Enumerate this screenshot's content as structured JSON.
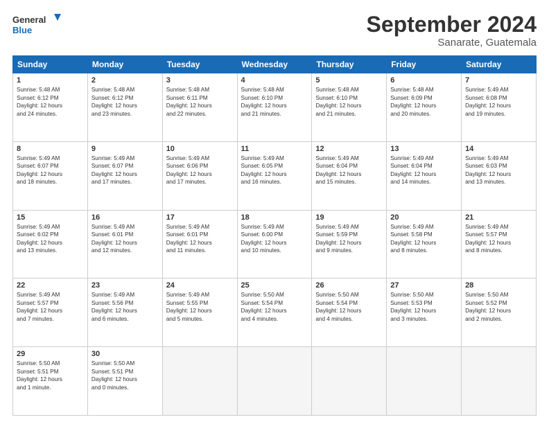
{
  "header": {
    "logo_line1": "General",
    "logo_line2": "Blue",
    "month_title": "September 2024",
    "subtitle": "Sanarate, Guatemala"
  },
  "days_of_week": [
    "Sunday",
    "Monday",
    "Tuesday",
    "Wednesday",
    "Thursday",
    "Friday",
    "Saturday"
  ],
  "weeks": [
    [
      {
        "day": "1",
        "text": "Sunrise: 5:48 AM\nSunset: 6:12 PM\nDaylight: 12 hours\nand 24 minutes."
      },
      {
        "day": "2",
        "text": "Sunrise: 5:48 AM\nSunset: 6:12 PM\nDaylight: 12 hours\nand 23 minutes."
      },
      {
        "day": "3",
        "text": "Sunrise: 5:48 AM\nSunset: 6:11 PM\nDaylight: 12 hours\nand 22 minutes."
      },
      {
        "day": "4",
        "text": "Sunrise: 5:48 AM\nSunset: 6:10 PM\nDaylight: 12 hours\nand 21 minutes."
      },
      {
        "day": "5",
        "text": "Sunrise: 5:48 AM\nSunset: 6:10 PM\nDaylight: 12 hours\nand 21 minutes."
      },
      {
        "day": "6",
        "text": "Sunrise: 5:48 AM\nSunset: 6:09 PM\nDaylight: 12 hours\nand 20 minutes."
      },
      {
        "day": "7",
        "text": "Sunrise: 5:49 AM\nSunset: 6:08 PM\nDaylight: 12 hours\nand 19 minutes."
      }
    ],
    [
      {
        "day": "8",
        "text": "Sunrise: 5:49 AM\nSunset: 6:07 PM\nDaylight: 12 hours\nand 18 minutes."
      },
      {
        "day": "9",
        "text": "Sunrise: 5:49 AM\nSunset: 6:07 PM\nDaylight: 12 hours\nand 17 minutes."
      },
      {
        "day": "10",
        "text": "Sunrise: 5:49 AM\nSunset: 6:06 PM\nDaylight: 12 hours\nand 17 minutes."
      },
      {
        "day": "11",
        "text": "Sunrise: 5:49 AM\nSunset: 6:05 PM\nDaylight: 12 hours\nand 16 minutes."
      },
      {
        "day": "12",
        "text": "Sunrise: 5:49 AM\nSunset: 6:04 PM\nDaylight: 12 hours\nand 15 minutes."
      },
      {
        "day": "13",
        "text": "Sunrise: 5:49 AM\nSunset: 6:04 PM\nDaylight: 12 hours\nand 14 minutes."
      },
      {
        "day": "14",
        "text": "Sunrise: 5:49 AM\nSunset: 6:03 PM\nDaylight: 12 hours\nand 13 minutes."
      }
    ],
    [
      {
        "day": "15",
        "text": "Sunrise: 5:49 AM\nSunset: 6:02 PM\nDaylight: 12 hours\nand 13 minutes."
      },
      {
        "day": "16",
        "text": "Sunrise: 5:49 AM\nSunset: 6:01 PM\nDaylight: 12 hours\nand 12 minutes."
      },
      {
        "day": "17",
        "text": "Sunrise: 5:49 AM\nSunset: 6:01 PM\nDaylight: 12 hours\nand 11 minutes."
      },
      {
        "day": "18",
        "text": "Sunrise: 5:49 AM\nSunset: 6:00 PM\nDaylight: 12 hours\nand 10 minutes."
      },
      {
        "day": "19",
        "text": "Sunrise: 5:49 AM\nSunset: 5:59 PM\nDaylight: 12 hours\nand 9 minutes."
      },
      {
        "day": "20",
        "text": "Sunrise: 5:49 AM\nSunset: 5:58 PM\nDaylight: 12 hours\nand 8 minutes."
      },
      {
        "day": "21",
        "text": "Sunrise: 5:49 AM\nSunset: 5:57 PM\nDaylight: 12 hours\nand 8 minutes."
      }
    ],
    [
      {
        "day": "22",
        "text": "Sunrise: 5:49 AM\nSunset: 5:57 PM\nDaylight: 12 hours\nand 7 minutes."
      },
      {
        "day": "23",
        "text": "Sunrise: 5:49 AM\nSunset: 5:56 PM\nDaylight: 12 hours\nand 6 minutes."
      },
      {
        "day": "24",
        "text": "Sunrise: 5:49 AM\nSunset: 5:55 PM\nDaylight: 12 hours\nand 5 minutes."
      },
      {
        "day": "25",
        "text": "Sunrise: 5:50 AM\nSunset: 5:54 PM\nDaylight: 12 hours\nand 4 minutes."
      },
      {
        "day": "26",
        "text": "Sunrise: 5:50 AM\nSunset: 5:54 PM\nDaylight: 12 hours\nand 4 minutes."
      },
      {
        "day": "27",
        "text": "Sunrise: 5:50 AM\nSunset: 5:53 PM\nDaylight: 12 hours\nand 3 minutes."
      },
      {
        "day": "28",
        "text": "Sunrise: 5:50 AM\nSunset: 5:52 PM\nDaylight: 12 hours\nand 2 minutes."
      }
    ],
    [
      {
        "day": "29",
        "text": "Sunrise: 5:50 AM\nSunset: 5:51 PM\nDaylight: 12 hours\nand 1 minute."
      },
      {
        "day": "30",
        "text": "Sunrise: 5:50 AM\nSunset: 5:51 PM\nDaylight: 12 hours\nand 0 minutes."
      },
      {
        "day": "",
        "text": ""
      },
      {
        "day": "",
        "text": ""
      },
      {
        "day": "",
        "text": ""
      },
      {
        "day": "",
        "text": ""
      },
      {
        "day": "",
        "text": ""
      }
    ]
  ]
}
